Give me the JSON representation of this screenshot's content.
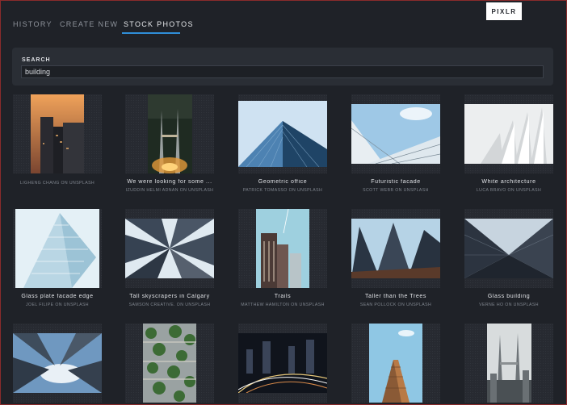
{
  "tabs": [
    {
      "label": "HISTORY"
    },
    {
      "label": "CREATE NEW"
    },
    {
      "label": "STOCK PHOTOS"
    }
  ],
  "logo": "PIXLR",
  "search": {
    "label": "SEARCH",
    "value": "building"
  },
  "accent_color": "#2f8fd8",
  "photos": [
    {
      "title": "",
      "credit": "LIGHENG CHANG ON UNSPLASH"
    },
    {
      "title": "We were looking for some ...",
      "credit": "IZUDDIN HELMI ADNAN ON UNSPLASH"
    },
    {
      "title": "Geometric office",
      "credit": "PATRICK TOMASSO ON UNSPLASH"
    },
    {
      "title": "Futuristic facade",
      "credit": "SCOTT WEBB ON UNSPLASH"
    },
    {
      "title": "White architecture",
      "credit": "LUCA BRAVO ON UNSPLASH"
    },
    {
      "title": "Glass plate facade edge",
      "credit": "JOEL FILIPE ON UNSPLASH"
    },
    {
      "title": "Tall skyscrapers in Calgary",
      "credit": "SAMSON CREATIVE. ON UNSPLASH"
    },
    {
      "title": "Trails",
      "credit": "MATTHEW HAMILTON ON UNSPLASH"
    },
    {
      "title": "Taller than the Trees",
      "credit": "SEAN POLLOCK ON UNSPLASH"
    },
    {
      "title": "Glass building",
      "credit": "VERNE HO ON UNSPLASH"
    },
    {
      "title": "",
      "credit": ""
    },
    {
      "title": "",
      "credit": ""
    },
    {
      "title": "",
      "credit": ""
    },
    {
      "title": "",
      "credit": ""
    },
    {
      "title": "",
      "credit": ""
    }
  ]
}
